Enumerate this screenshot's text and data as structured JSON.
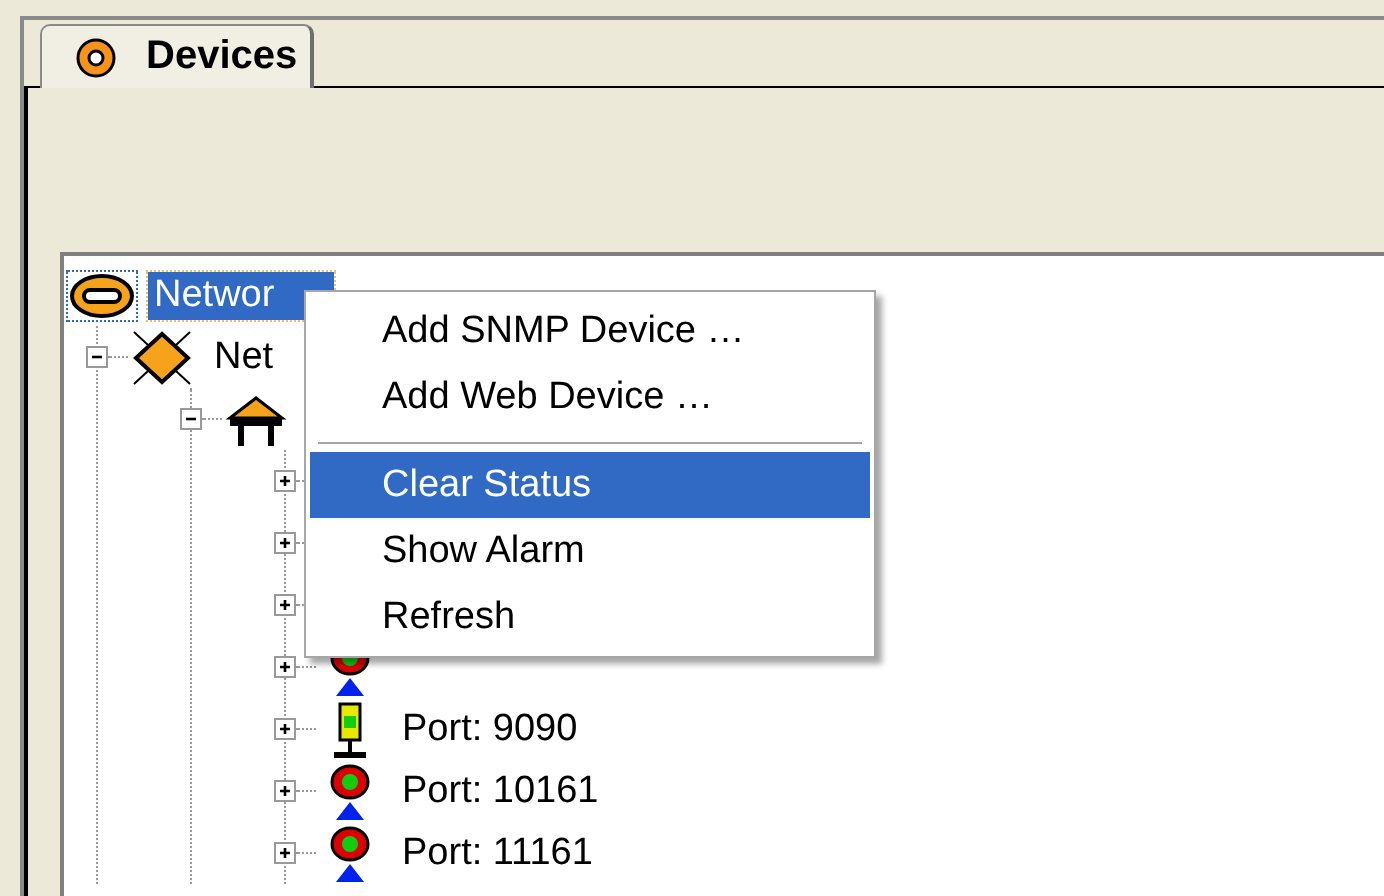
{
  "tabs": [
    {
      "label": "Devices",
      "selected": true
    }
  ],
  "tree": [
    {
      "label": "Networ",
      "kind": "ring",
      "selected": true,
      "children": [
        {
          "label": "Net",
          "kind": "diamond",
          "expanded": true,
          "selected": false,
          "children": [
            {
              "kind": "router",
              "expanded": true,
              "selected": false,
              "children": [
                {
                  "expanded": false,
                  "selected": false
                },
                {
                  "expanded": false,
                  "selected": false
                },
                {
                  "expanded": false,
                  "selected": false
                },
                {
                  "expanded": false,
                  "selected": false,
                  "kind": "beacon"
                },
                {
                  "label": "Port: 9090",
                  "kind": "light",
                  "expanded": false,
                  "selected": false
                },
                {
                  "label": "Port: 10161",
                  "kind": "beacon",
                  "expanded": false,
                  "selected": false
                },
                {
                  "label": "Port: 11161",
                  "kind": "beacon",
                  "expanded": false,
                  "selected": false
                }
              ]
            }
          ]
        }
      ]
    }
  ],
  "context_menu": [
    {
      "kind": "item",
      "label": "Add SNMP Device …",
      "selected": false
    },
    {
      "kind": "item",
      "label": "Add Web Device …",
      "selected": false
    },
    {
      "kind": "separator"
    },
    {
      "kind": "item",
      "label": "Clear Status",
      "selected": true
    },
    {
      "kind": "item",
      "label": "Show Alarm",
      "selected": false
    },
    {
      "kind": "item",
      "label": "Refresh",
      "selected": false
    }
  ]
}
